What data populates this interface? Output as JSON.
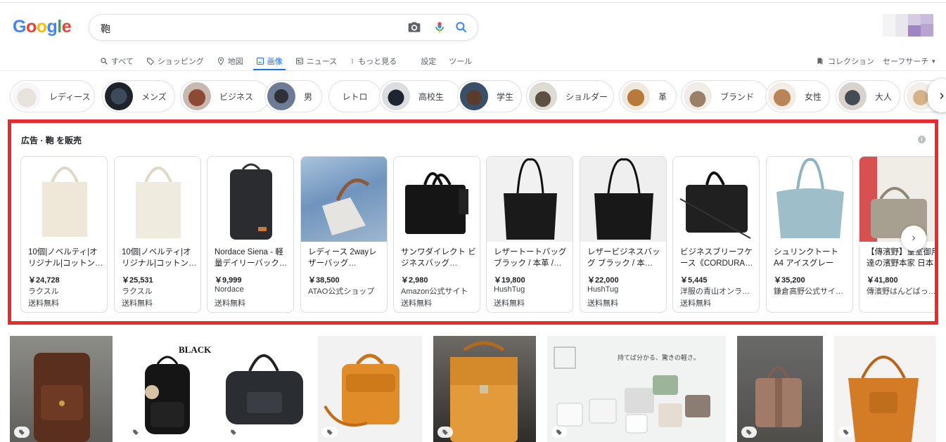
{
  "logo": "Google",
  "search": {
    "query": "鞄"
  },
  "tabs": [
    {
      "label": "すべて",
      "icon": "search-icon"
    },
    {
      "label": "ショッピング",
      "icon": "tag-icon"
    },
    {
      "label": "地図",
      "icon": "map-pin-icon"
    },
    {
      "label": "画像",
      "icon": "image-icon",
      "active": true
    },
    {
      "label": "ニュース",
      "icon": "news-icon"
    },
    {
      "label": "もっと見る",
      "icon": "more-vert-icon"
    },
    {
      "label": "設定"
    },
    {
      "label": "ツール"
    }
  ],
  "right_tools": {
    "collection": "コレクション",
    "safesearch": "セーフサーチ"
  },
  "chips": [
    {
      "label": "レディース"
    },
    {
      "label": "メンズ"
    },
    {
      "label": "ビジネス"
    },
    {
      "label": "男"
    },
    {
      "label": "レトロ"
    },
    {
      "label": "高校生"
    },
    {
      "label": "学生"
    },
    {
      "label": "ショルダー"
    },
    {
      "label": "革"
    },
    {
      "label": "ブランド"
    },
    {
      "label": "女性"
    },
    {
      "label": "大人"
    }
  ],
  "ads": {
    "header": "広告 · 鞄 を販売",
    "items": [
      {
        "title": "10個|ノベルティ|オリジナル|コットン…",
        "price": "￥24,728",
        "seller": "ラクスル",
        "shipping": "送料無料"
      },
      {
        "title": "10個|ノベルティ|オリジナル|コットン…",
        "price": "￥25,531",
        "seller": "ラクスル",
        "shipping": "送料無料"
      },
      {
        "title": "Nordace Siena - 軽量デイリーバック…",
        "price": "￥9,999",
        "seller": "Nordace",
        "shipping": "送料無料"
      },
      {
        "title": "レディース 2wayレザーバッグ…",
        "price": "￥38,500",
        "seller": "ATAO公式ショップ",
        "shipping": ""
      },
      {
        "title": "サンワダイレクト ビジネスバッグ…",
        "price": "￥2,980",
        "seller": "Amazon公式サイト",
        "shipping": "送料無料"
      },
      {
        "title": "レザートートバッグ ブラック / 本革 /…",
        "price": "￥19,800",
        "seller": "HushTug",
        "shipping": "送料無料"
      },
      {
        "title": "レザービジネスバッグ ブラック / 本…",
        "price": "￥22,000",
        "seller": "HushTug",
        "shipping": "送料無料"
      },
      {
        "title": "ビジネスブリーフケース《CORDURA…",
        "price": "￥5,445",
        "seller": "洋服の青山オンラ…",
        "shipping": "送料無料"
      },
      {
        "title": "シュリンクトート A4 アイスグレー",
        "price": "￥35,200",
        "seller": "鎌倉高野公式サイ…",
        "shipping": ""
      },
      {
        "title": "【傳濱野】皇室御用達の濱野本家 日本…",
        "price": "￥41,800",
        "seller": "傳濱野はんどばっ…",
        "shipping": ""
      }
    ]
  },
  "grid_banner_text": "持てば分かる、驚きの軽さ。",
  "grid_label_black": "BLACK"
}
